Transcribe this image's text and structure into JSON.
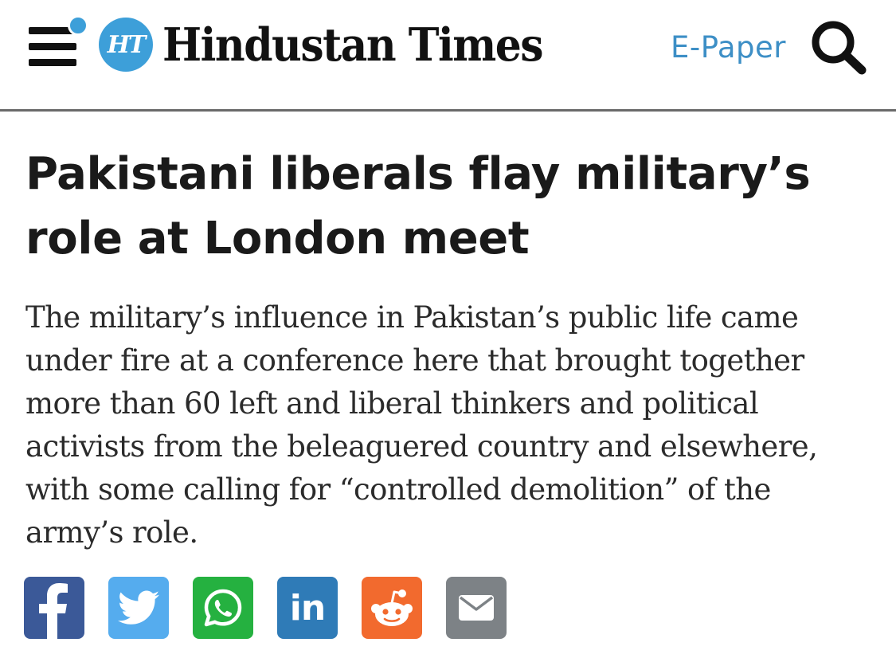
{
  "header": {
    "logo_badge_text": "HT",
    "logo_text": "Hindustan Times",
    "epaper_label": "E-Paper",
    "accent_color": "#3d9fd9",
    "icons": {
      "menu": "hamburger-menu-icon",
      "notification": "notification-dot-icon",
      "search": "search-icon"
    }
  },
  "article": {
    "headline": "Pakistani liberals flay military’s role at London meet",
    "summary": "The military’s influence in Pakistan’s public life came under fire at a conference here that brought together more than 60 left and liberal thinkers and political activists from the beleaguered country and elsewhere, with some calling for “controlled demolition” of the army’s role."
  },
  "share": {
    "buttons": [
      {
        "network": "facebook",
        "icon": "facebook-icon",
        "color": "#3b5998"
      },
      {
        "network": "twitter",
        "icon": "twitter-icon",
        "color": "#55acee"
      },
      {
        "network": "whatsapp",
        "icon": "whatsapp-icon",
        "color": "#25b140"
      },
      {
        "network": "linkedin",
        "icon": "linkedin-icon",
        "label": "in",
        "color": "#2f7bb7"
      },
      {
        "network": "reddit",
        "icon": "reddit-icon",
        "color": "#f26a2e"
      },
      {
        "network": "email",
        "icon": "email-icon",
        "color": "#7d8286"
      }
    ]
  }
}
